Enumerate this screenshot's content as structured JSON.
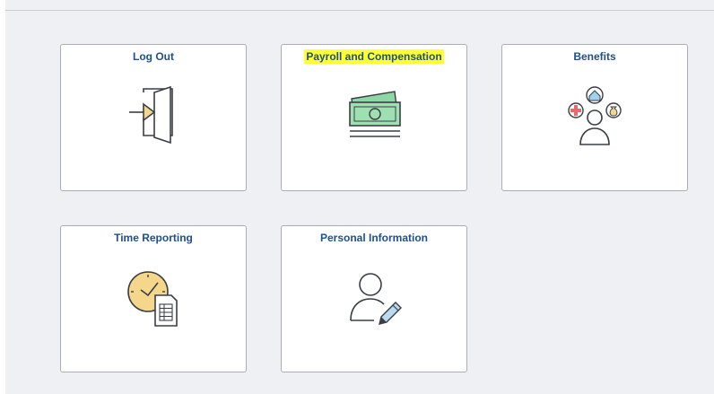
{
  "tiles": {
    "logout": {
      "title": "Log Out",
      "icon": "log-out-door-icon"
    },
    "payroll": {
      "title": "Payroll and Compensation",
      "icon": "money-stack-icon",
      "highlight": "#ffff33"
    },
    "benefits": {
      "title": "Benefits",
      "icon": "benefits-person-icon"
    },
    "time_reporting": {
      "title": "Time Reporting",
      "icon": "clock-timesheet-icon"
    },
    "personal_info": {
      "title": "Personal Information",
      "icon": "person-edit-icon"
    }
  },
  "colors": {
    "title_text": "#1d4f91",
    "page_background": "#eff0f3",
    "tile_border": "#a9aeb6",
    "highlight": "#ffff33"
  }
}
